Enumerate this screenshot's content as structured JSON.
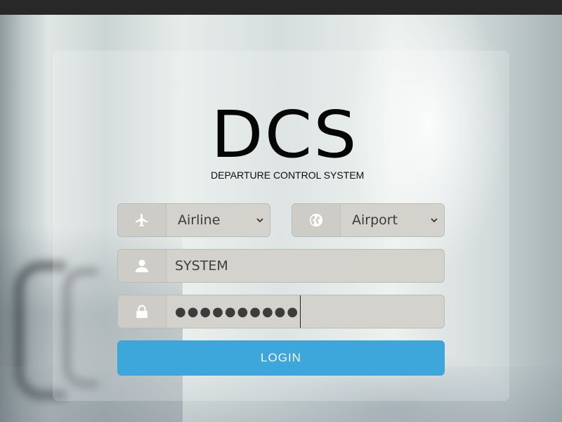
{
  "logo": {
    "title": "DCS",
    "subtitle": "DEPARTURE CONTROL SYSTEM"
  },
  "form": {
    "airline": {
      "selected": "Airline",
      "icon": "airplane-icon"
    },
    "airport": {
      "selected": "Airport",
      "icon": "globe-icon"
    },
    "username": {
      "value": "SYSTEM",
      "icon": "user-icon"
    },
    "password": {
      "masked_value": "●●●●●●●●●●",
      "icon": "lock-icon"
    },
    "login_label": "LOGIN"
  },
  "colors": {
    "accent": "#3da7db",
    "field_bg": "#d3d2cd",
    "topbar": "#282828"
  }
}
